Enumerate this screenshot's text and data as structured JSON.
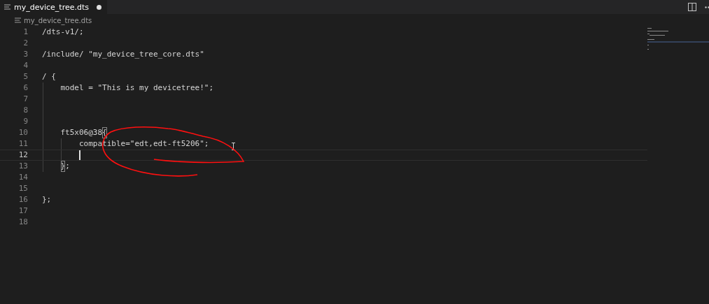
{
  "tabs": [
    {
      "label": "my_device_tree.dts",
      "selected": true,
      "modified": true
    }
  ],
  "breadcrumb": "my_device_tree.dts",
  "lines": [
    {
      "number": "1",
      "text": "/dts-v1/;"
    },
    {
      "number": "2"
    },
    {
      "number": "3",
      "text": "/include/ \"my_device_tree_core.dts\""
    },
    {
      "number": "4"
    },
    {
      "number": "5",
      "text": "/ {"
    },
    {
      "number": "6",
      "text": "    model = \"This is my devicetree!\";"
    },
    {
      "number": "7"
    },
    {
      "number": "8"
    },
    {
      "number": "9"
    },
    {
      "number": "10",
      "text": "    ft5x06@38{",
      "bracket_highlighted": true
    },
    {
      "number": "11",
      "text": "        compatible=\"edt,edt-ft5206\";"
    },
    {
      "number": "12",
      "current": true
    },
    {
      "number": "13",
      "text": "    };",
      "bracket_highlighted": true
    },
    {
      "number": "14"
    },
    {
      "number": "15"
    },
    {
      "number": "16",
      "text": "};"
    },
    {
      "number": "17"
    },
    {
      "number": "18"
    }
  ]
}
